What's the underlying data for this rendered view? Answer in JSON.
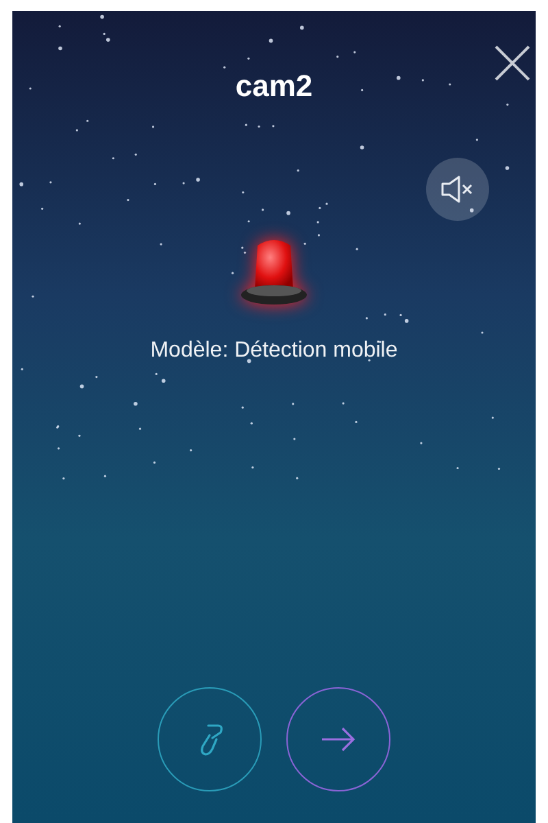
{
  "title": "cam2",
  "alarm": {
    "label": "Modèle: Détection mobile"
  }
}
